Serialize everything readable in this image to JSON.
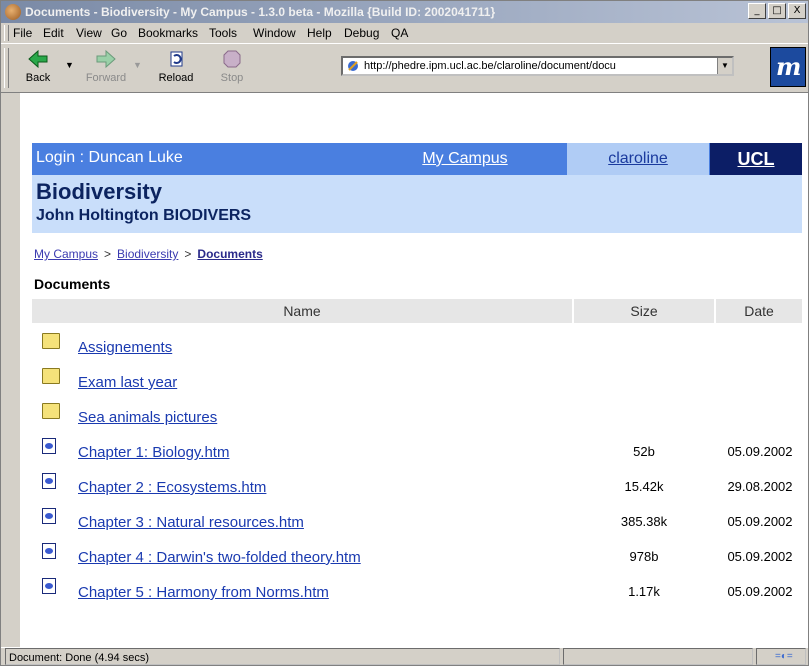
{
  "window": {
    "title": "Documents - Biodiversity - My Campus - 1.3.0 beta - Mozilla {Build ID: 2002041711}",
    "controls": [
      "_",
      "□",
      "X"
    ]
  },
  "menu": [
    "File",
    "Edit",
    "View",
    "Go",
    "Bookmarks",
    "Tools",
    "Window",
    "Help",
    "Debug",
    "QA"
  ],
  "toolbar": {
    "back": "Back",
    "forward": "Forward",
    "reload": "Reload",
    "stop": "Stop",
    "url": "http://phedre.ipm.ucl.ac.be/claroline/document/docu"
  },
  "banner": {
    "login": "Login : Duncan Luke",
    "my_campus": "My Campus",
    "claroline": "claroline",
    "ucl": "UCL"
  },
  "course": {
    "title": "Biodiversity",
    "subtitle": "John Holtington BIODIVERS"
  },
  "breadcrumb": [
    "My Campus",
    ">",
    "Biodiversity",
    ">",
    "Documents"
  ],
  "page_title": "Documents",
  "table": {
    "headers": [
      "Name",
      "Size",
      "Date"
    ],
    "rows": [
      {
        "type": "folder",
        "name": "Assignements",
        "size": "",
        "date": ""
      },
      {
        "type": "folder",
        "name": "Exam last year",
        "size": "",
        "date": ""
      },
      {
        "type": "folder",
        "name": "Sea animals pictures",
        "size": "",
        "date": ""
      },
      {
        "type": "file",
        "name": "Chapter 1: Biology.htm",
        "size": "52b",
        "date": "05.09.2002"
      },
      {
        "type": "file",
        "name": "Chapter 2 : Ecosystems.htm",
        "size": "15.42k",
        "date": "29.08.2002"
      },
      {
        "type": "file",
        "name": "Chapter 3 : Natural resources.htm",
        "size": "385.38k",
        "date": "05.09.2002"
      },
      {
        "type": "file",
        "name": "Chapter 4 : Darwin's two-folded theory.htm",
        "size": "978b",
        "date": "05.09.2002"
      },
      {
        "type": "file",
        "name": "Chapter 5 : Harmony from Norms.htm",
        "size": "1.17k",
        "date": "05.09.2002"
      }
    ]
  },
  "status": {
    "text": "Document: Done (4.94 secs)"
  },
  "colors": {
    "banner_blue": "#4a7fe0",
    "claroline_bg": "#b0ccf5",
    "ucl_bg": "#0c1e66",
    "course_header_bg": "#c9defa",
    "link": "#1a3ab0"
  },
  "icons": {
    "folder": "folder-icon",
    "file": "html-file-icon"
  }
}
